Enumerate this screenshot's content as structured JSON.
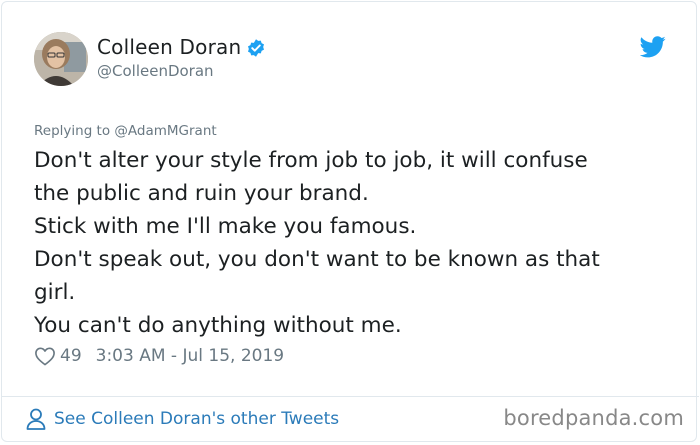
{
  "author": {
    "name": "Colleen Doran",
    "handle": "@ColleenDoran",
    "verified": true
  },
  "tweet": {
    "reply_to": "Replying to @AdamMGrant",
    "lines": [
      "Don't alter your style from job to job, it will confuse",
      "the public and ruin your brand.",
      "Stick with me I'll make you famous.",
      "Don't speak out, you don't want to be known as that",
      "girl.",
      "You can't do anything without me."
    ],
    "likes": "49",
    "timestamp": "3:03 AM - Jul 15, 2019"
  },
  "footer": {
    "link_text": "See Colleen Doran's other Tweets",
    "watermark": "boredpanda.com"
  },
  "colors": {
    "link_blue": "#2b7bb9",
    "twitter_blue": "#1da1f2",
    "muted_text": "#697882",
    "border": "#e1e8ed"
  },
  "icons": {
    "verified": "verified-badge-icon",
    "brand": "twitter-bird-icon",
    "like": "heart-icon",
    "profile": "person-icon"
  }
}
